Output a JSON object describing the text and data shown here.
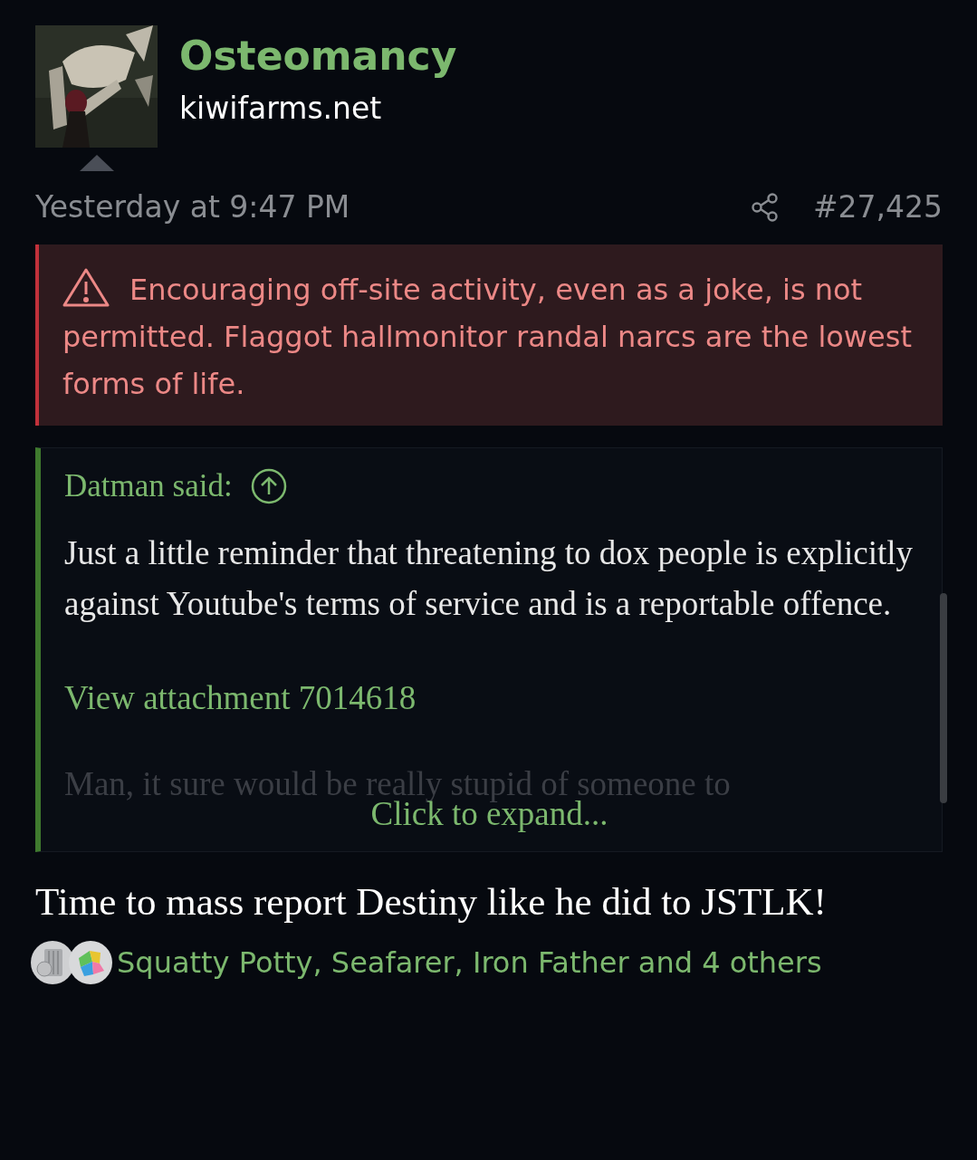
{
  "post": {
    "author": "Osteomancy",
    "site": "kiwifarms.net",
    "time": "Yesterday at 9:47 PM",
    "number": "#27,425"
  },
  "warning": {
    "text": "Encouraging off-site activity, even as a joke, is not permitted. Flaggot hallmonitor randal narcs are the lowest forms of life."
  },
  "quote": {
    "author": "Datman said:",
    "paragraphs": [
      "Just a little reminder that threatening to dox people is explicitly against Youtube's terms of service and is a reportable offence."
    ],
    "attachment": "View attachment 7014618",
    "faded": "Man, it sure would be really stupid of someone to",
    "expand": "Click to expand..."
  },
  "body": "Time to mass report Destiny like he did to JSTLK!",
  "reactions": {
    "text": "Squatty Potty, Seafarer, Iron Father and 4 others"
  }
}
